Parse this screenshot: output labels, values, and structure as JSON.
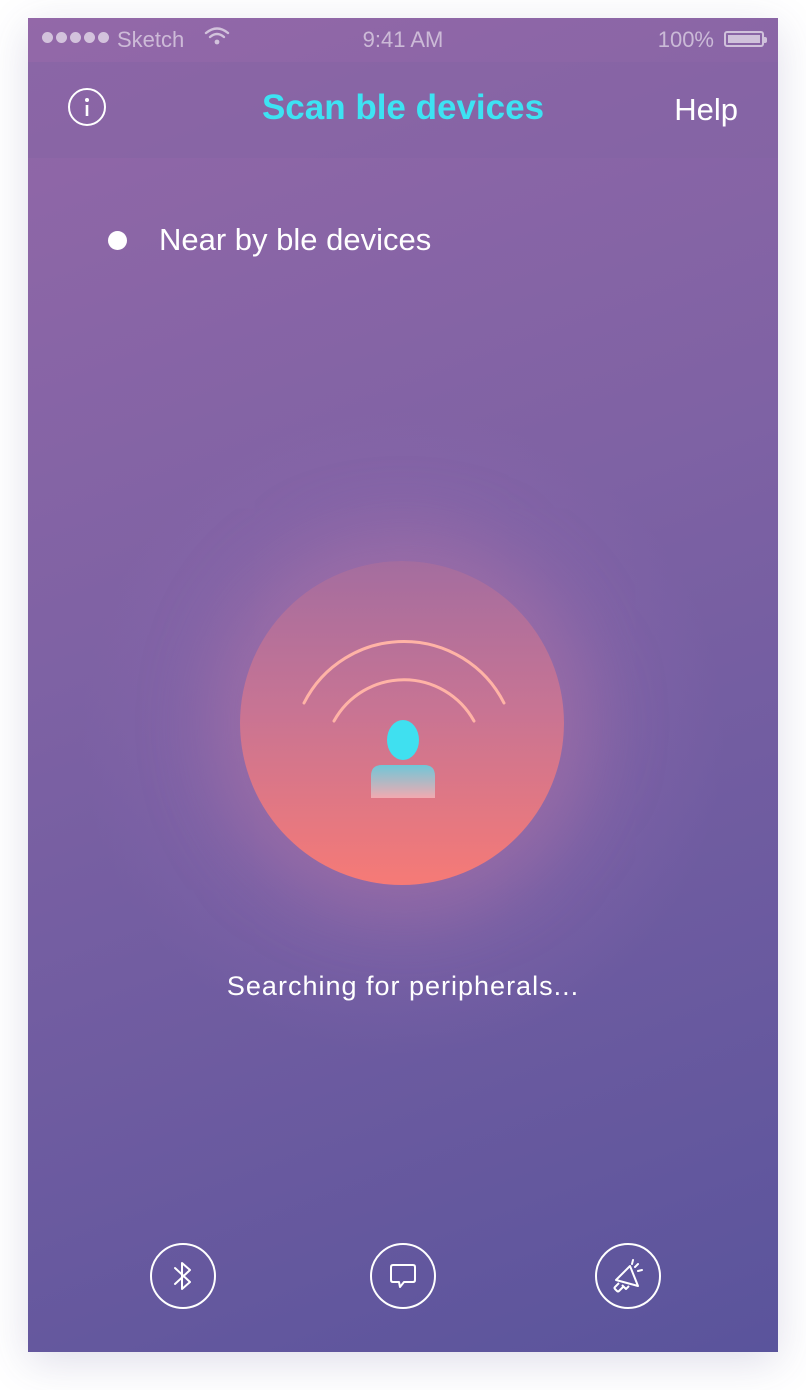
{
  "status_bar": {
    "carrier": "Sketch",
    "time": "9:41 AM",
    "battery_percent": "100%"
  },
  "nav": {
    "title": "Scan ble devices",
    "help_label": "Help",
    "info_icon": "info-icon"
  },
  "section": {
    "label": "Near by ble devices"
  },
  "scanner": {
    "status_text": "Searching for peripherals...",
    "icon": "user-broadcast-icon"
  },
  "tab_bar": {
    "items": [
      {
        "icon": "bluetooth-icon"
      },
      {
        "icon": "chat-icon"
      },
      {
        "icon": "megaphone-icon"
      }
    ]
  },
  "colors": {
    "title_accent": "#3de3f3",
    "circle_top": "#a46d9f",
    "circle_bottom": "#f67a76",
    "background_top": "#9368a8",
    "background_bottom": "#5a549c"
  }
}
